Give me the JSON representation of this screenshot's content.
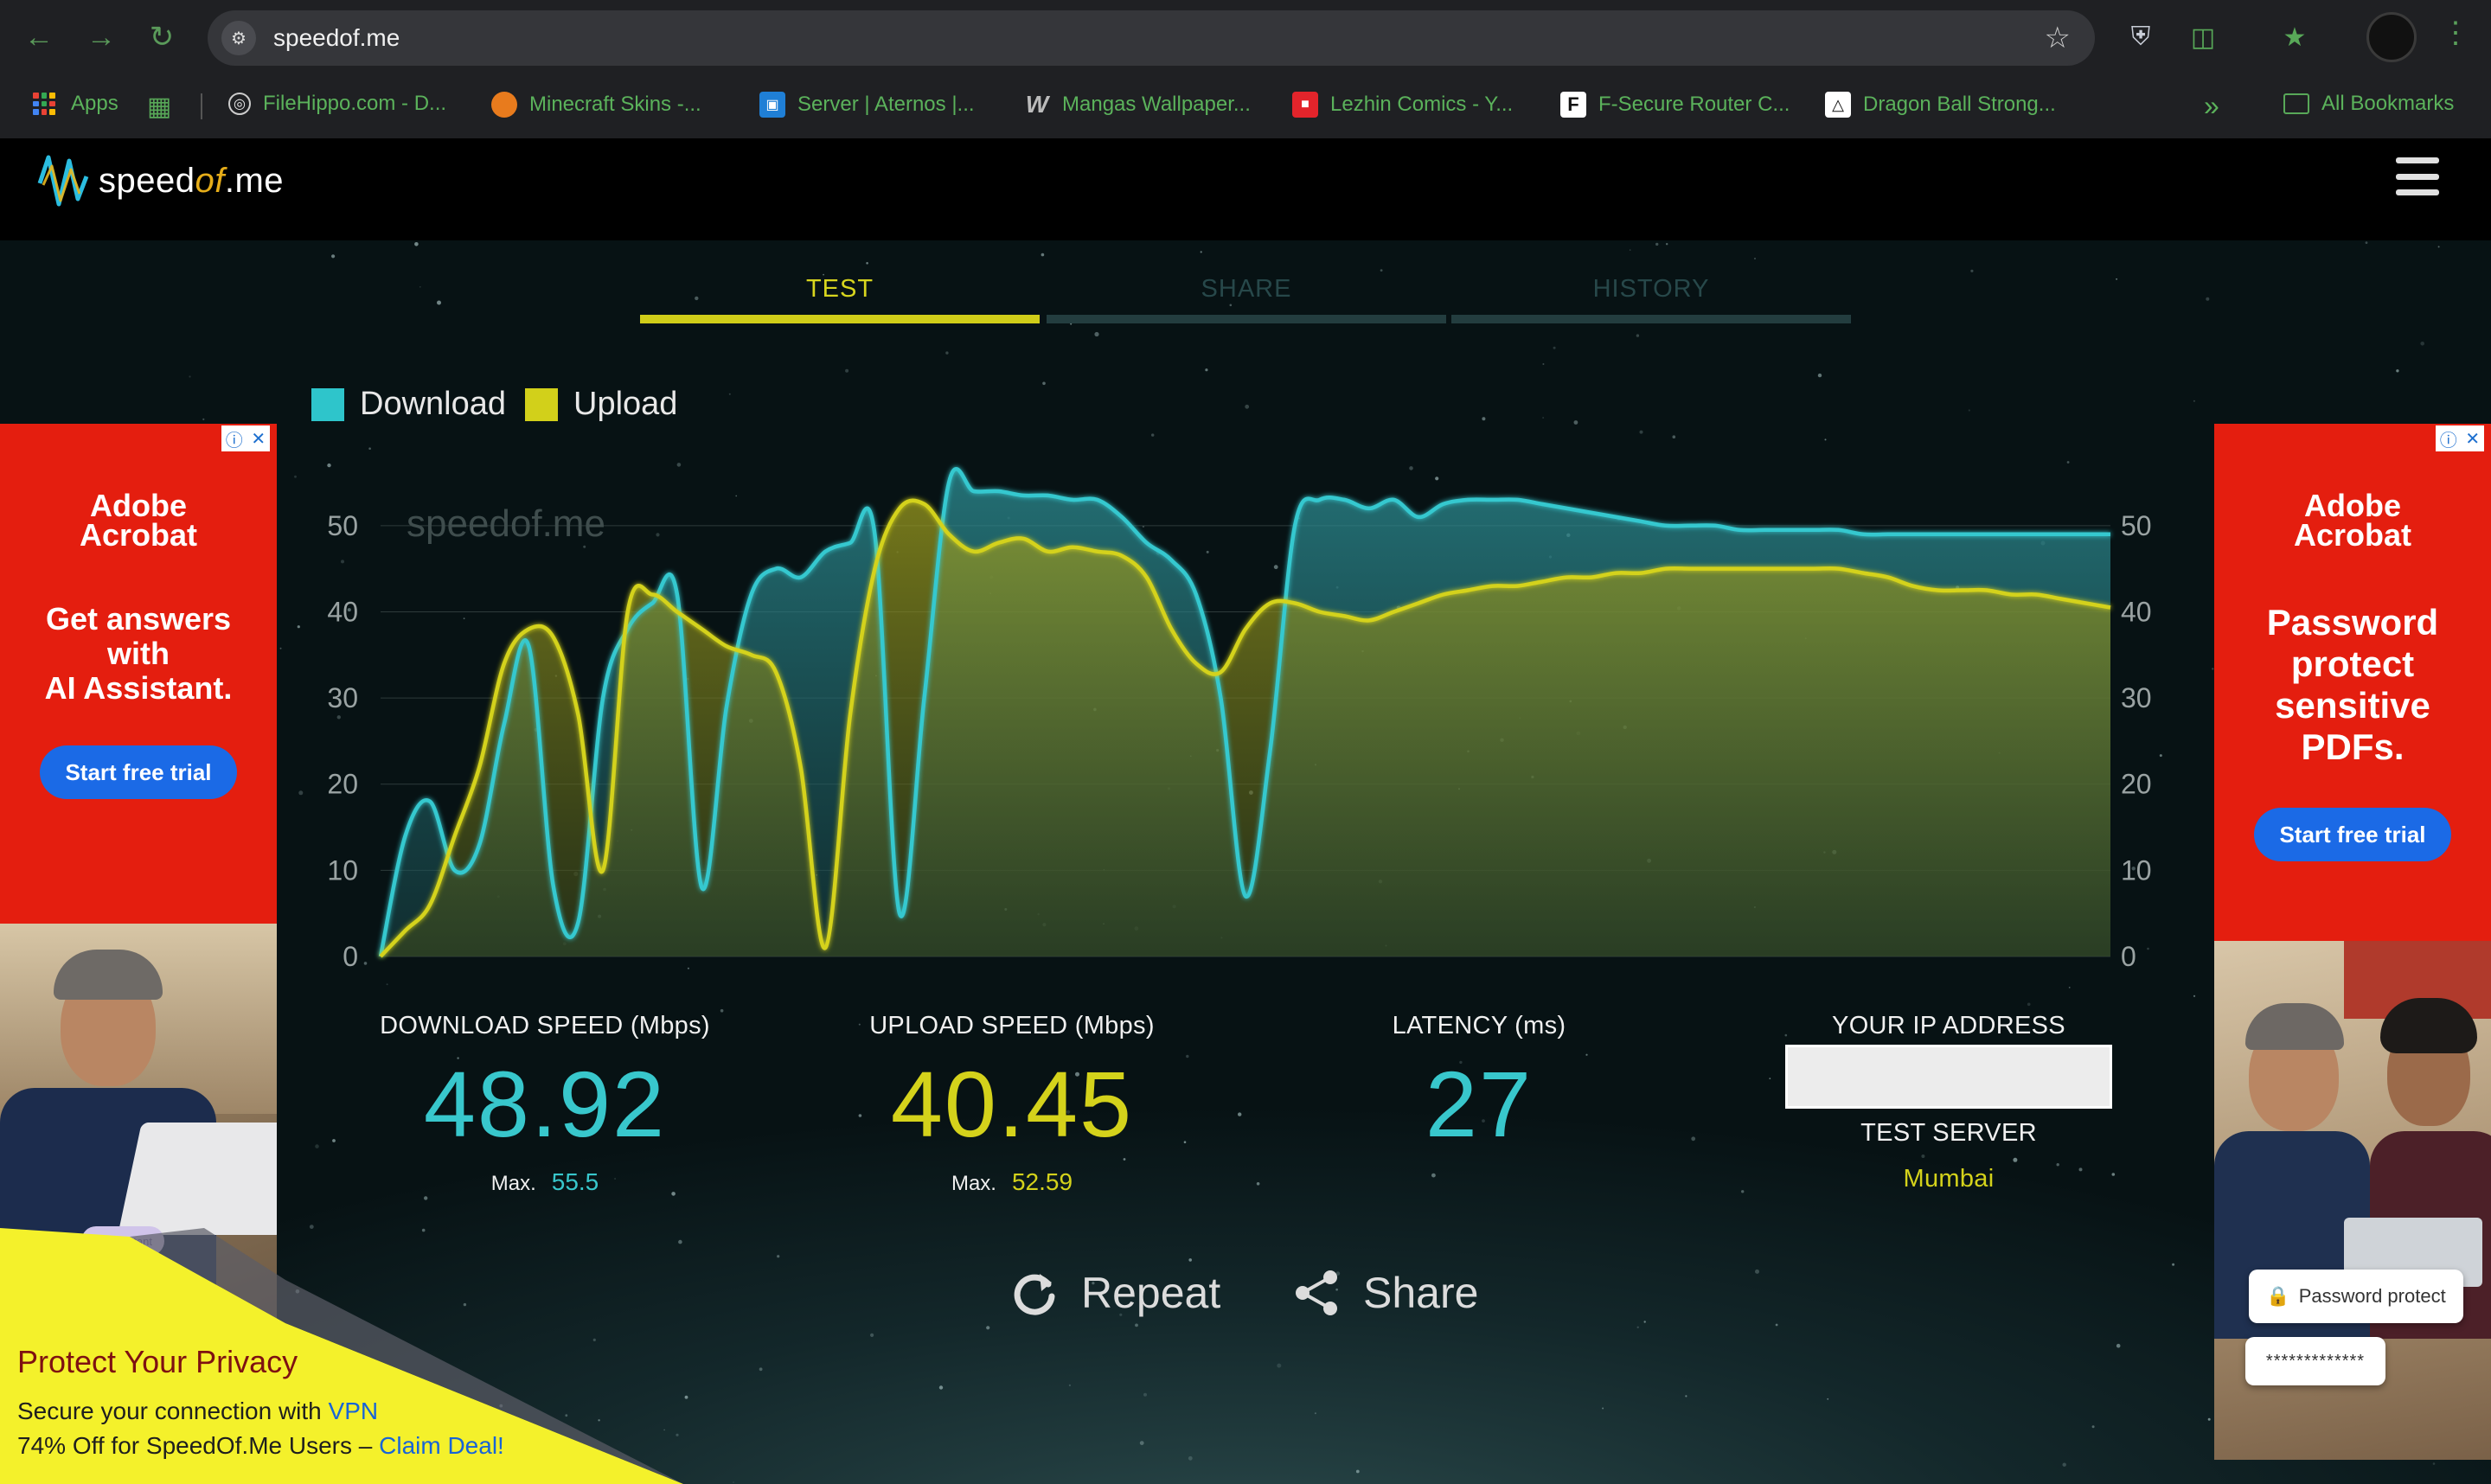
{
  "browser": {
    "url": "speedof.me",
    "bookmarks": [
      {
        "label": "Apps",
        "icon": "apps-grid-icon"
      },
      {
        "label": "FileHippo.com - D...",
        "icon": "globe-icon"
      },
      {
        "label": "Minecraft Skins -...",
        "icon": "pumpkin-icon"
      },
      {
        "label": "Server | Aternos |...",
        "icon": "aternos-icon"
      },
      {
        "label": "Mangas Wallpaper...",
        "icon": "w-logo-icon"
      },
      {
        "label": "Lezhin Comics - Y...",
        "icon": "lezhin-icon"
      },
      {
        "label": "F-Secure Router C...",
        "icon": "fsecure-icon"
      },
      {
        "label": "Dragon Ball Strong...",
        "icon": "triangle-icon"
      }
    ],
    "all_bookmarks": "All Bookmarks",
    "overflow": "»"
  },
  "site": {
    "brand_prefix": "speed",
    "brand_mid": "of",
    "brand_suffix": ".me"
  },
  "tabs": [
    {
      "label": "TEST",
      "active": true
    },
    {
      "label": "SHARE",
      "active": false
    },
    {
      "label": "HISTORY",
      "active": false
    }
  ],
  "legend": {
    "download": "Download",
    "upload": "Upload"
  },
  "chart_data": {
    "type": "area",
    "watermark": "speedof.me",
    "ylim": [
      0,
      55
    ],
    "yticks": [
      0,
      10,
      20,
      30,
      40,
      50
    ],
    "colors": {
      "download": "#36c8cf",
      "upload": "#d4d21a"
    },
    "x": [
      0,
      1,
      2,
      3,
      4,
      5,
      6,
      7,
      8,
      9,
      10,
      11,
      12,
      13,
      14,
      15,
      16,
      17,
      18,
      19,
      20,
      21,
      22,
      23,
      24,
      25,
      26,
      27,
      28,
      29,
      30,
      31,
      32,
      33,
      34,
      35,
      36,
      37,
      38,
      39,
      40,
      41,
      42,
      43,
      44,
      45,
      46,
      47,
      48,
      49,
      50,
      51,
      52,
      53,
      54,
      55,
      56,
      57,
      58,
      59,
      60,
      61,
      62,
      63,
      64,
      65,
      66,
      67,
      68,
      69,
      70
    ],
    "series": [
      {
        "name": "Download",
        "values": [
          0,
          14,
          18,
          10,
          13,
          27,
          36,
          8,
          4,
          30,
          38,
          41,
          42,
          8,
          29,
          42,
          45,
          44,
          47,
          48,
          49,
          5,
          30,
          55,
          54,
          54,
          53.5,
          53.5,
          53,
          53,
          51,
          48,
          46,
          42,
          30,
          7,
          24,
          50,
          53,
          53,
          52,
          53,
          51,
          52.5,
          53,
          53,
          53,
          52.5,
          52,
          51.5,
          51,
          50.5,
          50,
          50,
          50,
          49.5,
          49.5,
          49.5,
          49.5,
          49.5,
          49,
          49,
          49,
          49,
          49,
          49,
          49,
          49,
          49,
          49,
          49
        ]
      },
      {
        "name": "Upload",
        "values": [
          0,
          3,
          6,
          14,
          22,
          34,
          38,
          37,
          28,
          10,
          40,
          42,
          40,
          38,
          36,
          35,
          33,
          22,
          1,
          28,
          45,
          52,
          52.5,
          49,
          47,
          48,
          48.5,
          47,
          47.5,
          47,
          46.5,
          44,
          38,
          34,
          33,
          38,
          41,
          41,
          40,
          39.5,
          39,
          40,
          41,
          42,
          42.5,
          43,
          43,
          43.5,
          44,
          44,
          44.5,
          44.5,
          45,
          45,
          45,
          45,
          45,
          45,
          45,
          45,
          44.5,
          44,
          43,
          42.5,
          42.5,
          42.5,
          42,
          42,
          41.5,
          41,
          40.5
        ]
      }
    ]
  },
  "stats": {
    "download": {
      "header": "DOWNLOAD SPEED (Mbps)",
      "value": "48.92",
      "max_label": "Max.",
      "max_value": "55.5"
    },
    "upload": {
      "header": "UPLOAD SPEED (Mbps)",
      "value": "40.45",
      "max_label": "Max.",
      "max_value": "52.59"
    },
    "latency": {
      "header": "LATENCY (ms)",
      "value": "27"
    },
    "ip": {
      "header": "YOUR IP ADDRESS",
      "value": ""
    },
    "server": {
      "header": "TEST SERVER",
      "value": "Mumbai"
    }
  },
  "actions": {
    "repeat": "Repeat",
    "share": "Share"
  },
  "ads": {
    "left": {
      "product_line1": "Adobe",
      "product_line2": "Acrobat",
      "headline_line1": "Get answers",
      "headline_line2": "with",
      "headline_line3": "AI Assistant.",
      "cta": "Start free trial",
      "badge": "AI Assistant"
    },
    "right": {
      "product_line1": "Adobe",
      "product_line2": "Acrobat",
      "headline_line1": "Password",
      "headline_line2": "protect",
      "headline_line3": "sensitive",
      "headline_line4": "PDFs.",
      "cta": "Start free trial",
      "pw_label": "Password protect",
      "pw_dots": "*************"
    }
  },
  "promo": {
    "title": "Protect Your Privacy",
    "line1_text": "Secure your connection with ",
    "line1_link": "VPN",
    "line2_text": "74% Off for SpeedOf.Me Users – ",
    "line2_link": "Claim Deal!"
  }
}
